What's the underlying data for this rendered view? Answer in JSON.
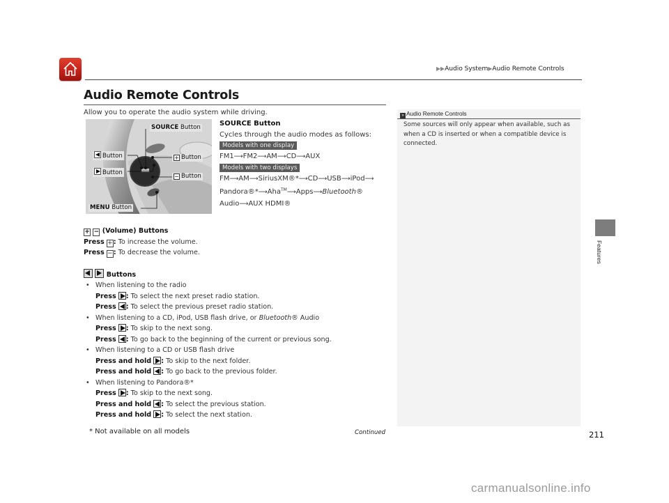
{
  "header": {
    "home_icon": "home-icon",
    "breadcrumb": [
      "Audio System",
      "Audio Remote Controls"
    ],
    "breadcrumb_separator_icon": "triangle-right-icon"
  },
  "page": {
    "title": "Audio Remote Controls",
    "intro": "Allow you to operate the audio system while driving."
  },
  "figure": {
    "labels": {
      "source": "SOURCE",
      "source_suffix": "Button",
      "left": "Button",
      "right": "Button",
      "plus": "Button",
      "minus": "Button",
      "menu": "MENU",
      "menu_suffix": "Button"
    }
  },
  "source_section": {
    "heading": "SOURCE Button",
    "desc": "Cycles through the audio modes as follows:",
    "badge_one": "Models with one display",
    "sequence_one": [
      "FM1",
      "FM2",
      "AM",
      "CD",
      "AUX"
    ],
    "badge_two": "Models with two displays",
    "sequence_two_line1": [
      "FM",
      "AM",
      "SiriusXM®*",
      "CD",
      "USB",
      "iPod"
    ],
    "sequence_two_line2_a": "Pandora®*",
    "sequence_two_line2_b": "Aha",
    "sequence_two_line2_tm": "TM",
    "sequence_two_line2_c": "Apps",
    "sequence_two_line2_d": "Bluetooth",
    "sequence_two_line2_reg": "®",
    "sequence_two_line3_a": "Audio",
    "sequence_two_line3_b": "AUX HDMI®"
  },
  "volume_section": {
    "heading": "(Volume) Buttons",
    "press": "Press",
    "plus_desc": "To increase the volume.",
    "minus_desc": "To decrease the volume."
  },
  "skip_section": {
    "heading": "Buttons",
    "groups": [
      {
        "bullet": "When listening to the radio",
        "items": [
          {
            "action": "Press",
            "dir": "right",
            "desc": "To select the next preset radio station."
          },
          {
            "action": "Press",
            "dir": "left",
            "desc": "To select the previous preset radio station."
          }
        ]
      },
      {
        "bullet": "When listening to a CD, iPod, USB flash drive, or",
        "bullet_italic": "Bluetooth",
        "bullet_tail": "® Audio",
        "items": [
          {
            "action": "Press",
            "dir": "right",
            "desc": "To skip to the next song."
          },
          {
            "action": "Press",
            "dir": "left",
            "desc": "To go back to the beginning of the current or previous song."
          }
        ]
      },
      {
        "bullet": "When listening to a CD or USB flash drive",
        "items": [
          {
            "action": "Press and hold",
            "dir": "right",
            "desc": "To skip to the next folder."
          },
          {
            "action": "Press and hold",
            "dir": "left",
            "desc": "To go back to the previous folder."
          }
        ]
      },
      {
        "bullet": "When listening to Pandora®*",
        "items": [
          {
            "action": "Press",
            "dir": "right",
            "desc": "To skip to the next song."
          },
          {
            "action": "Press and hold",
            "dir": "left",
            "desc": "To select the previous station."
          },
          {
            "action": "Press and hold",
            "dir": "right",
            "desc": "To select the next station."
          }
        ]
      }
    ]
  },
  "side_note": {
    "heading": "Audio Remote Controls",
    "text": "Some sources will only appear when available, such as when a CD is inserted or when a compatible device is connected."
  },
  "section_tab": {
    "label": "Features",
    "color": "#7d7d7d"
  },
  "footer": {
    "footnote": "* Not available on all models",
    "continued": "Continued",
    "page_number": "211",
    "watermark": "carmanualsonline.info"
  },
  "colors": {
    "home_button": "#c4221a",
    "badge": "#5a5a5a",
    "side_panel": "#f3f3f3"
  }
}
